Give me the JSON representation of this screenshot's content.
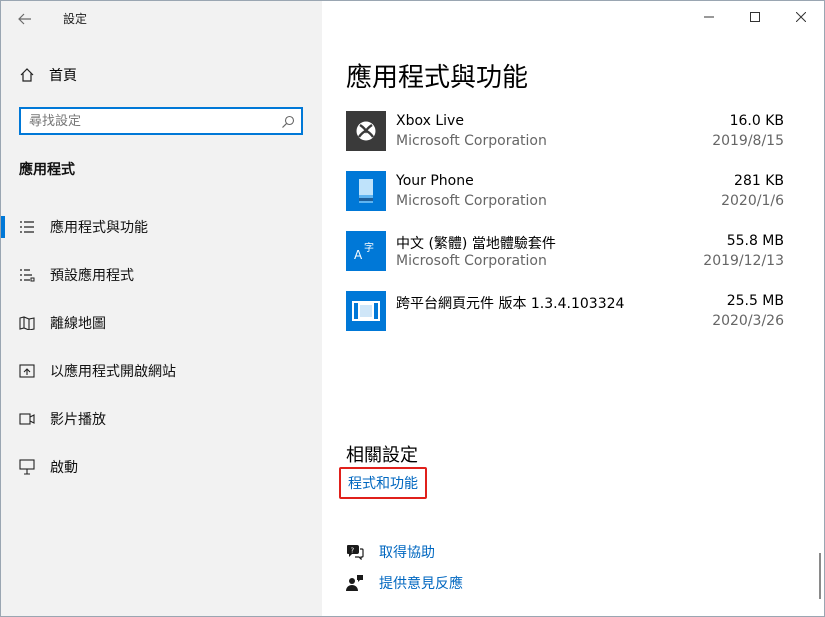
{
  "window": {
    "title": "設定"
  },
  "sidebar": {
    "home_label": "首頁",
    "search_placeholder": "尋找設定",
    "section_heading": "應用程式",
    "items": [
      {
        "label": "應用程式與功能",
        "icon": "list-icon",
        "active": true
      },
      {
        "label": "預設應用程式",
        "icon": "default-apps-icon",
        "active": false
      },
      {
        "label": "離線地圖",
        "icon": "map-icon",
        "active": false
      },
      {
        "label": "以應用程式開啟網站",
        "icon": "open-website-icon",
        "active": false
      },
      {
        "label": "影片播放",
        "icon": "video-icon",
        "active": false
      },
      {
        "label": "啟動",
        "icon": "startup-icon",
        "active": false
      }
    ]
  },
  "main": {
    "page_title": "應用程式與功能",
    "apps": [
      {
        "name": "Xbox Live",
        "publisher": "Microsoft Corporation",
        "size": "16.0 KB",
        "date": "2019/8/15",
        "icon": "xbox-icon",
        "icon_bg": "#3a3a3a"
      },
      {
        "name": "Your Phone",
        "publisher": "Microsoft Corporation",
        "size": "281 KB",
        "date": "2020/1/6",
        "icon": "phone-icon",
        "icon_bg": "#0078d7"
      },
      {
        "name": "中文 (繁體) 當地體驗套件",
        "publisher": "Microsoft Corporation",
        "size": "55.8 MB",
        "date": "2019/12/13",
        "icon": "language-icon",
        "icon_bg": "#0078d7"
      },
      {
        "name": "跨平台網頁元件 版本 1.3.4.103324",
        "publisher": "",
        "size": "25.5 MB",
        "date": "2020/3/26",
        "icon": "web-component-icon",
        "icon_bg": "#0078d7"
      }
    ],
    "related_title": "相關設定",
    "related_link": "程式和功能",
    "help_label": "取得協助",
    "feedback_label": "提供意見反應"
  },
  "colors": {
    "accent": "#0078d7",
    "link": "#0067c0",
    "highlight_border": "#e0201b",
    "sidebar_bg": "#f2f2f2"
  }
}
